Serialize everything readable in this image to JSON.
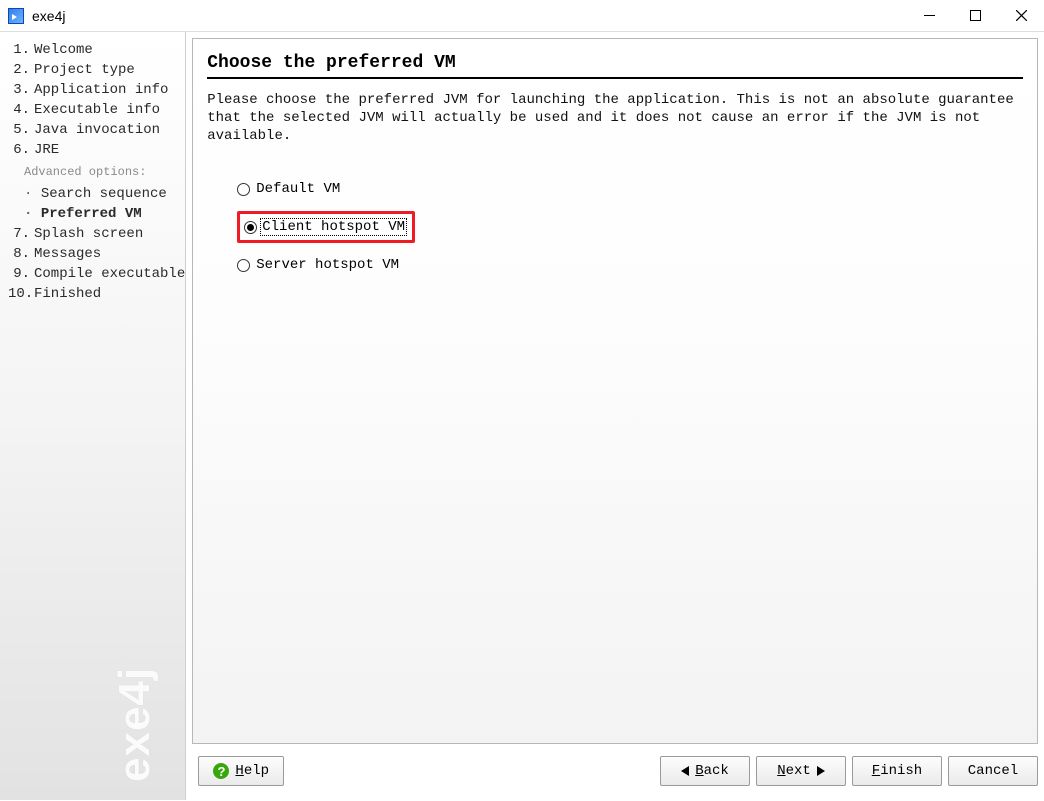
{
  "window": {
    "title": "exe4j",
    "brand": "exe4j"
  },
  "sidebar": {
    "advanced_label": "Advanced options:",
    "items": [
      {
        "num": "1.",
        "label": "Welcome"
      },
      {
        "num": "2.",
        "label": "Project type"
      },
      {
        "num": "3.",
        "label": "Application info"
      },
      {
        "num": "4.",
        "label": "Executable info"
      },
      {
        "num": "5.",
        "label": "Java invocation"
      },
      {
        "num": "6.",
        "label": "JRE"
      },
      {
        "label": "Search sequence",
        "sub": true
      },
      {
        "label": "Preferred VM",
        "sub": true,
        "current": true
      },
      {
        "num": "7.",
        "label": "Splash screen"
      },
      {
        "num": "8.",
        "label": "Messages"
      },
      {
        "num": "9.",
        "label": "Compile executable"
      },
      {
        "num": "10.",
        "label": "Finished"
      }
    ]
  },
  "page": {
    "heading": "Choose the preferred VM",
    "description": "Please choose the preferred JVM for launching the application. This is not an absolute guarantee that the selected JVM will actually be used and it does not cause an error if the JVM is not available.",
    "options": [
      {
        "id": "default",
        "label": "Default VM",
        "selected": false
      },
      {
        "id": "client",
        "label": "Client hotspot VM",
        "selected": true,
        "highlight": true
      },
      {
        "id": "server",
        "label": "Server hotspot VM",
        "selected": false
      }
    ]
  },
  "footer": {
    "help": "Help",
    "back": "Back",
    "next": "Next",
    "finish": "Finish",
    "cancel": "Cancel"
  }
}
